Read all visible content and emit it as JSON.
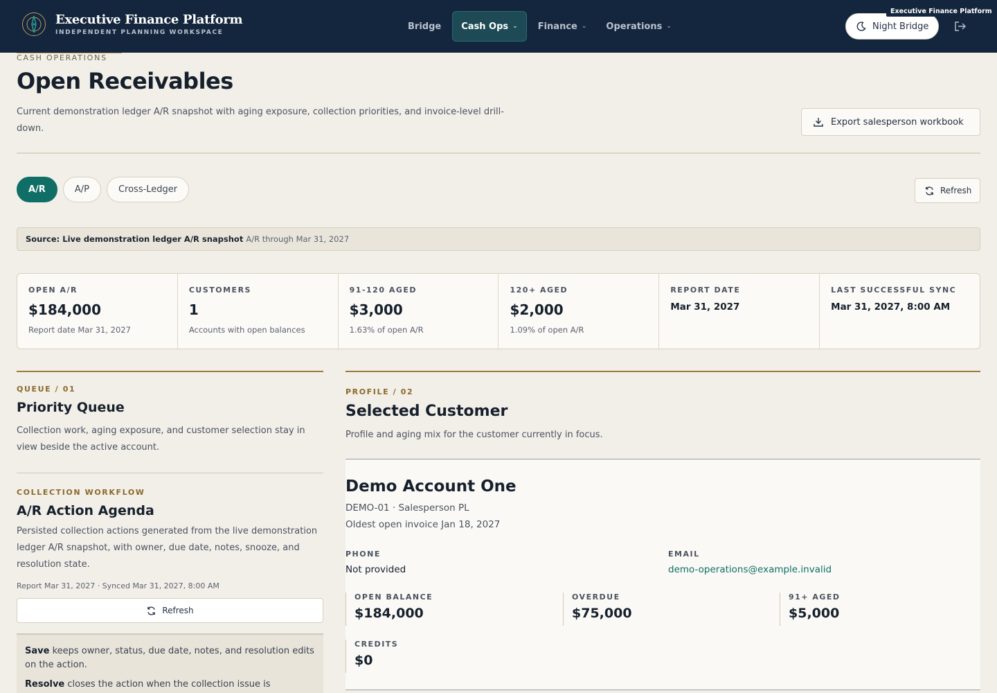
{
  "app": {
    "title": "Executive Finance Platform",
    "subtitle": "INDEPENDENT PLANNING WORKSPACE",
    "tooltip": "Executive Finance Platform",
    "theme_label": "Night Bridge"
  },
  "nav": [
    {
      "label": "Bridge",
      "dropdown": false,
      "active": false
    },
    {
      "label": "Cash Ops",
      "dropdown": true,
      "active": true
    },
    {
      "label": "Finance",
      "dropdown": true,
      "active": false
    },
    {
      "label": "Operations",
      "dropdown": true,
      "active": false
    }
  ],
  "header": {
    "eyebrow": "CASH OPERATIONS",
    "title": "Open Receivables",
    "description": "Current demonstration ledger A/R snapshot with aging exposure, collection priorities, and invoice-level drill-down.",
    "export_label": "Export salesperson workbook"
  },
  "tabs": [
    {
      "label": "A/R",
      "active": true
    },
    {
      "label": "A/P",
      "active": false
    },
    {
      "label": "Cross-Ledger",
      "active": false
    }
  ],
  "refresh_label": "Refresh",
  "source": {
    "label": "Source: Live demonstration ledger A/R snapshot",
    "detail": "A/R through Mar 31, 2027"
  },
  "kpis": [
    {
      "label": "OPEN A/R",
      "value": "$184,000",
      "note": "Report date Mar 31, 2027"
    },
    {
      "label": "CUSTOMERS",
      "value": "1",
      "note": "Accounts with open balances"
    },
    {
      "label": "91-120 AGED",
      "value": "$3,000",
      "note": "1.63% of open A/R"
    },
    {
      "label": "120+ AGED",
      "value": "$2,000",
      "note": "1.09% of open A/R"
    },
    {
      "label": "REPORT DATE",
      "value": "Mar 31, 2027",
      "note": ""
    },
    {
      "label": "LAST SUCCESSFUL SYNC",
      "value": "Mar 31, 2027, 8:00 AM",
      "note": ""
    }
  ],
  "queue": {
    "eyebrow": "QUEUE / 01",
    "title": "Priority Queue",
    "description": "Collection work, aging exposure, and customer selection stay in view beside the active account."
  },
  "workflow": {
    "eyebrow": "COLLECTION WORKFLOW",
    "title": "A/R Action Agenda",
    "description": "Persisted collection actions generated from the live demonstration ledger A/R snapshot, with owner, due date, notes, snooze, and resolution state.",
    "meta": "Report Mar 31, 2027 · Synced Mar 31, 2027, 8:00 AM",
    "refresh_label": "Refresh",
    "help": [
      {
        "term": "Save",
        "text": " keeps owner, status, due date, notes, and resolution edits on the action."
      },
      {
        "term": "Resolve",
        "text": " closes the action when the collection issue is"
      }
    ]
  },
  "profile": {
    "eyebrow": "PROFILE / 02",
    "title": "Selected Customer",
    "description": "Profile and aging mix for the customer currently in focus.",
    "customer": {
      "name": "Demo Account One",
      "code_line": "DEMO-01 · Salesperson PL",
      "oldest_line": "Oldest open invoice Jan 18, 2027",
      "phone_label": "PHONE",
      "phone": "Not provided",
      "email_label": "EMAIL",
      "email": "demo-operations@example.invalid",
      "metrics": [
        {
          "label": "OPEN BALANCE",
          "value": "$184,000"
        },
        {
          "label": "OVERDUE",
          "value": "$75,000"
        },
        {
          "label": "91+ AGED",
          "value": "$5,000"
        },
        {
          "label": "CREDITS",
          "value": "$0"
        }
      ]
    }
  }
}
